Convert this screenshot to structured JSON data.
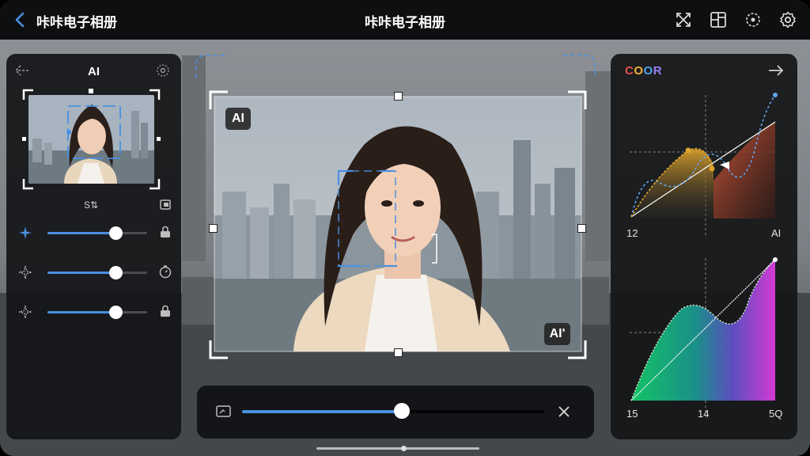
{
  "header": {
    "back_icon": "chevron-left-icon",
    "title_left": "咔咔电子相册",
    "title_center": "咔咔电子相册",
    "icons": [
      "crossing-arrows-icon",
      "layout-icon",
      "focus-target-icon",
      "gear-icon"
    ]
  },
  "left_panel": {
    "back_icon": "arrow-left-icon",
    "title": "AI",
    "settings_icon": "dotted-gear-icon",
    "thumbnail_caption": "S⇅",
    "thumbnail_action_icon": "copy-icon",
    "sliders": [
      {
        "icon": "sparkle-icon",
        "value": 0.68,
        "end_icon": "lock-icon"
      },
      {
        "icon": "dotted-sparkle-icon",
        "value": 0.68,
        "end_icon": "timer-icon"
      },
      {
        "icon": "dotted-sparkle-icon",
        "value": 0.68,
        "end_icon": "lock-icon"
      }
    ]
  },
  "canvas": {
    "badge_top": "AI",
    "badge_bottom": "AI'"
  },
  "bottom_bar": {
    "left_icon": "image-edit-icon",
    "value": 0.53,
    "close_icon": "close-icon"
  },
  "right_panel": {
    "title_chars": [
      "C",
      "O",
      "O",
      "R"
    ],
    "title_colors": [
      "#e8504e",
      "#f2b134",
      "#4fa6f0",
      "#9a7df5"
    ],
    "arrow_icon": "arrow-right-icon",
    "curve1_labels": {
      "left": "12",
      "right": "AI"
    },
    "curve2_labels": {
      "left": "15",
      "mid": "14",
      "right": "5Q"
    }
  },
  "colors": {
    "accent": "#4a90e2",
    "panel": "#141517"
  }
}
